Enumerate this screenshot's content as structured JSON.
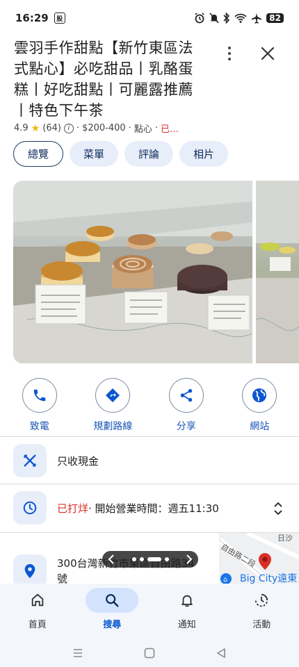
{
  "status_bar": {
    "time": "16:29",
    "app_badge": "股",
    "battery": "82"
  },
  "place": {
    "title": "雲羽手作甜點【新竹東區法式點心】必吃甜品丨乳酪蛋糕丨好吃甜點丨可麗露推薦丨特色下午茶",
    "rating": "4.9",
    "review_count": "(64)",
    "price": "$200-400",
    "category": "點心",
    "status_short": "已…",
    "sep": "·"
  },
  "tabs": [
    {
      "label": "總覽"
    },
    {
      "label": "菜單"
    },
    {
      "label": "評論"
    },
    {
      "label": "相片"
    }
  ],
  "actions": [
    {
      "label": "致電",
      "icon": "phone-icon"
    },
    {
      "label": "規劃路線",
      "icon": "directions-icon"
    },
    {
      "label": "分享",
      "icon": "share-icon"
    },
    {
      "label": "網站",
      "icon": "globe-icon"
    }
  ],
  "info": {
    "payment": "只收現金",
    "hours_status": "已打烊",
    "hours_detail": "· 開始營業時間：週五11:30",
    "address": "300台灣新竹市東區自由路34號"
  },
  "map": {
    "road_label": "自由路二段",
    "district_label": "日沙",
    "poi_label": "Big City遠東"
  },
  "bottom_nav": [
    {
      "label": "首頁",
      "icon": "home-icon"
    },
    {
      "label": "搜尋",
      "icon": "search-icon",
      "active": true
    },
    {
      "label": "通知",
      "icon": "bell-icon"
    },
    {
      "label": "活動",
      "icon": "activity-icon"
    }
  ],
  "colors": {
    "accent": "#0b57d0",
    "closed": "#d93025",
    "chip_bg": "#e8eef9"
  }
}
